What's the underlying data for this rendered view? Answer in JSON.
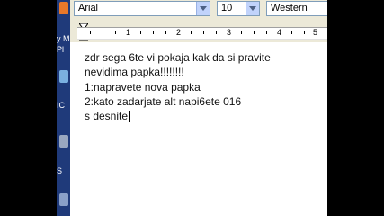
{
  "desktop": {
    "labels": [
      "y M",
      "Pl",
      "IC",
      "S"
    ]
  },
  "toolbar": {
    "font_name": "Arial",
    "font_size": "10",
    "script": "Western"
  },
  "ruler": {
    "numbers": [
      "1",
      "2",
      "3",
      "4",
      "5",
      "6"
    ]
  },
  "document": {
    "lines": [
      "zdr sega 6te vi pokaja kak da si pravite",
      "nevidima papka!!!!!!!!",
      "1:napravete nova papka",
      "2:kato zadarjate alt napi6ete 016",
      "s desnite"
    ]
  },
  "colors": {
    "desktop": "#1f3a7a",
    "chrome": "#ece9d8"
  }
}
